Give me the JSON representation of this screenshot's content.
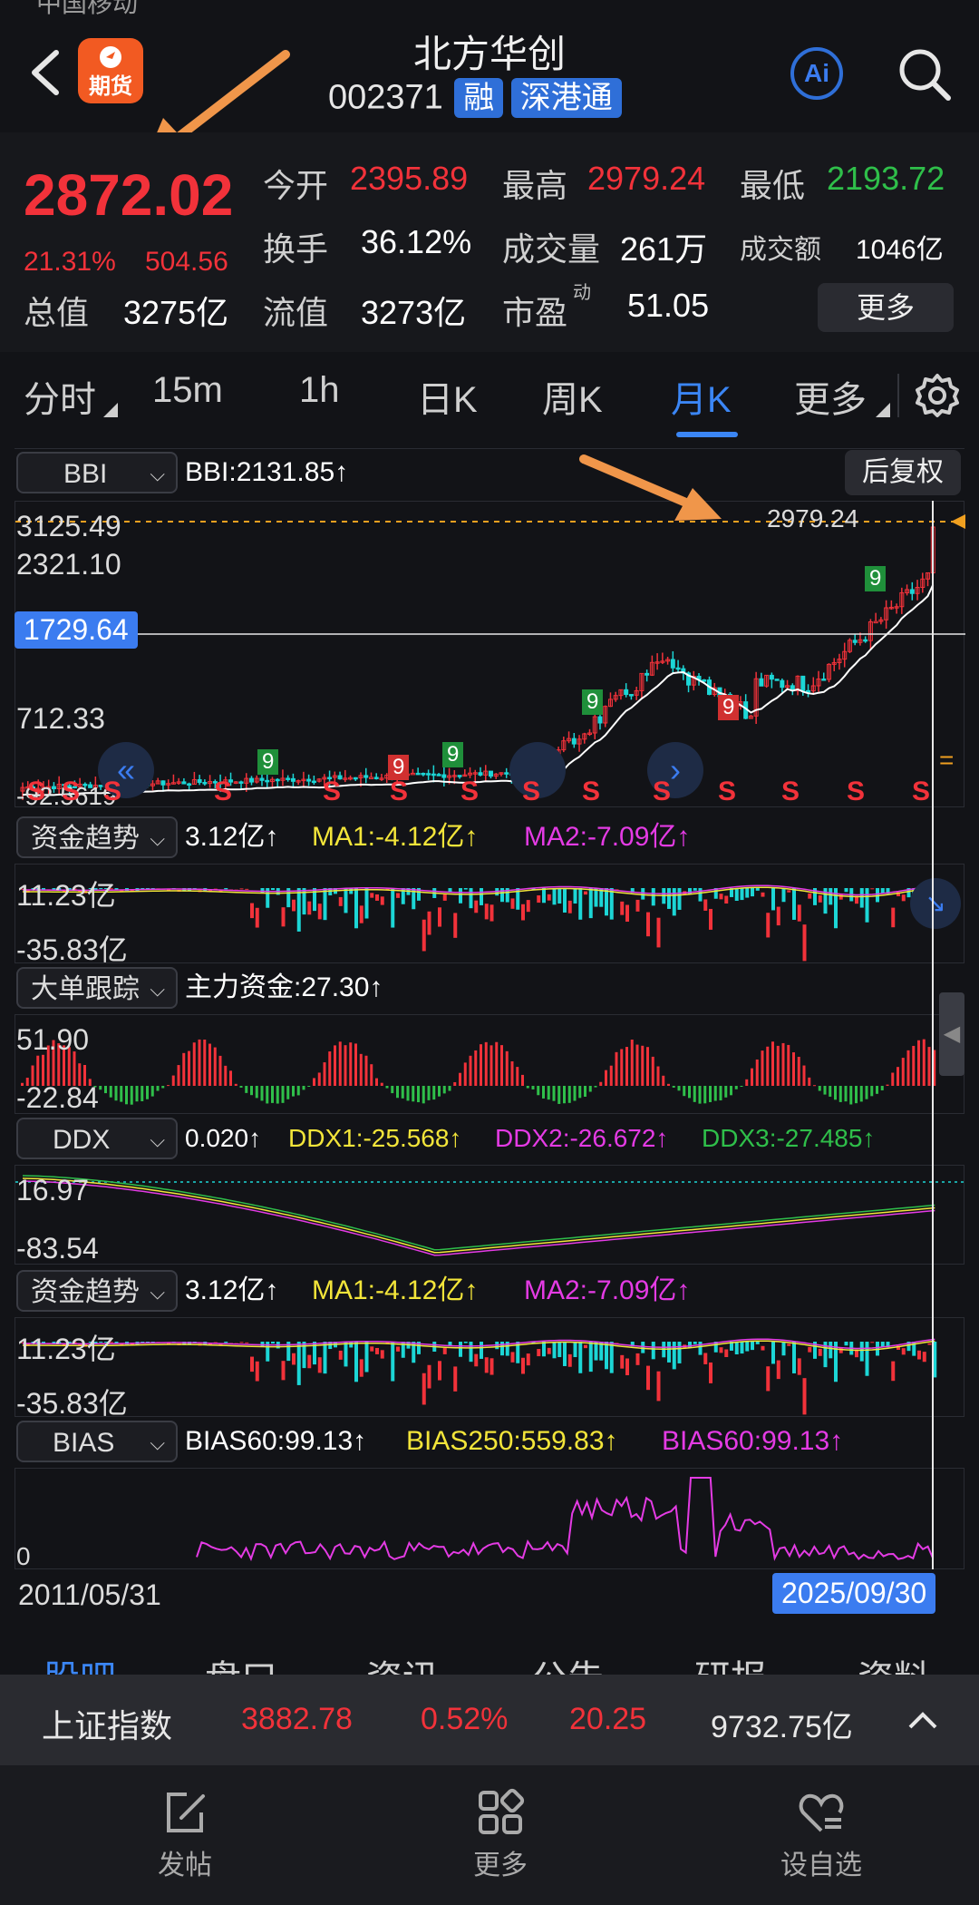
{
  "status_bar": {
    "text": "中国移动"
  },
  "header": {
    "title": "北方华创",
    "code": "002371",
    "tag_margin": "融",
    "tag_connect": "深港通",
    "futures_label": "期货",
    "ai_label": "Ai"
  },
  "quote": {
    "price": "2872.02",
    "change_pct": "21.31%",
    "change_abs": "504.56",
    "open_label": "今开",
    "open": "2395.89",
    "high_label": "最高",
    "high": "2979.24",
    "low_label": "最低",
    "low": "2193.72",
    "turnover_label": "换手",
    "turnover": "36.12%",
    "volume_label": "成交量",
    "volume": "261万",
    "amount_label": "成交额",
    "amount": "1046亿",
    "mktcap_label": "总值",
    "mktcap": "3275亿",
    "float_label": "流值",
    "float_cap": "3273亿",
    "pe_label": "市盈",
    "pe_sup": "动",
    "pe": "51.05",
    "more_button": "更多"
  },
  "period_tabs": [
    "分时",
    "15m",
    "1h",
    "日K",
    "周K",
    "月K",
    "更多"
  ],
  "active_tab": "月K",
  "main_chart": {
    "indicator": "BBI",
    "indicator_value": "BBI:2131.85↑",
    "adjust_button": "后复权",
    "y_labels": [
      "3125.49",
      "2321.10",
      "712.33",
      "-92.5619"
    ],
    "crosshair_value": "1729.64",
    "high_marker": "2979.24",
    "s_marker": "S",
    "td_numbers": [
      "9",
      "9",
      "9",
      "9",
      "9",
      "9"
    ]
  },
  "fund_trend_1": {
    "indicator": "资金趋势",
    "value": "3.12亿↑",
    "ma1": "MA1:-4.12亿↑",
    "ma2": "MA2:-7.09亿↑",
    "y_top": "11.23亿",
    "y_bottom": "-35.83亿"
  },
  "big_order": {
    "indicator": "大单跟踪",
    "value": "主力资金:27.30↑",
    "y_top": "51.90",
    "y_bottom": "-22.84"
  },
  "ddx": {
    "indicator": "DDX",
    "value": "0.020↑",
    "ddx1": "DDX1:-25.568↑",
    "ddx2": "DDX2:-26.672↑",
    "ddx3": "DDX3:-27.485↑",
    "y_top": "16.97",
    "y_bottom": "-83.54"
  },
  "fund_trend_2": {
    "indicator": "资金趋势",
    "value": "3.12亿↑",
    "ma1": "MA1:-4.12亿↑",
    "ma2": "MA2:-7.09亿↑",
    "y_top": "11.23亿",
    "y_bottom": "-35.83亿"
  },
  "bias": {
    "indicator": "BIAS",
    "bias60": "BIAS60:99.13↑",
    "bias250": "BIAS250:559.83↑",
    "bias60b": "BIAS60:99.13↑",
    "y_bottom": "0"
  },
  "date_axis": {
    "start": "2011/05/31",
    "end": "2025/09/30"
  },
  "bottom_tabs_partial": [
    "股吧",
    "盘口",
    "资讯",
    "公告",
    "研报",
    "资料"
  ],
  "index_bar": {
    "name": "上证指数",
    "value": "3882.78",
    "pct": "0.52%",
    "change": "20.25",
    "amount": "9732.75亿"
  },
  "bottom_nav": [
    {
      "label": "发帖",
      "icon": "edit-icon"
    },
    {
      "label": "更多",
      "icon": "grid-icon"
    },
    {
      "label": "设自选",
      "icon": "heart-list-icon"
    }
  ],
  "colors": {
    "up": "#f2323a",
    "down": "#2fbf4a",
    "accent": "#2f6fd8",
    "arrow": "#f0964a"
  }
}
